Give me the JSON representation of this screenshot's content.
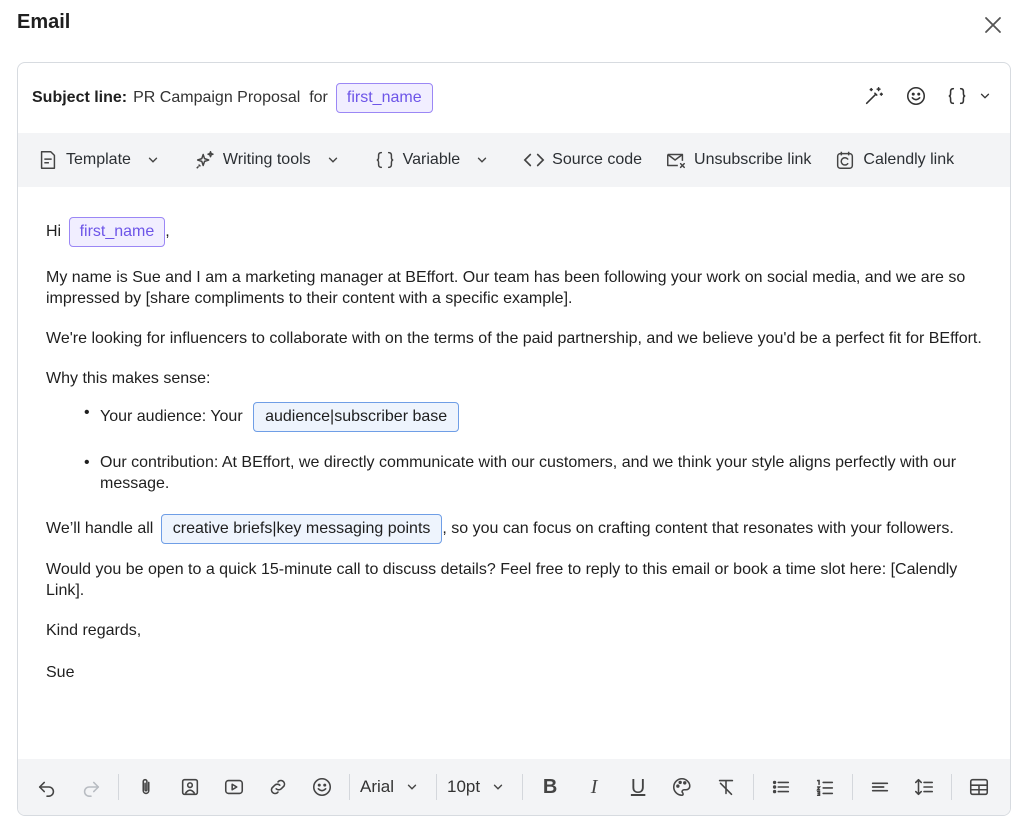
{
  "dialog": {
    "title": "Email"
  },
  "subject": {
    "label": "Subject line:",
    "text": "PR Campaign Proposal  for",
    "variable": "first_name"
  },
  "toolbar": {
    "template": "Template",
    "writing_tools": "Writing tools",
    "variable": "Variable",
    "source_code": "Source code",
    "unsubscribe_link": "Unsubscribe link",
    "calendly_link": "Calendly link"
  },
  "body": {
    "greeting_prefix": "Hi",
    "greeting_variable": "first_name",
    "greeting_suffix": ",",
    "p1": "My name is Sue and I am a marketing manager at BEffort. Our team has been following your work on social media, and we are so impressed by [share compliments to their content with a specific example].",
    "p2": "We're looking for influencers to collaborate with on the terms of the paid partnership, and we believe you'd be a perfect fit for BEffort.",
    "p3": "Why this makes sense:",
    "bullet1_prefix": "Your audience: Your",
    "bullet1_chip": "audience|subscriber base",
    "bullet2": "Our contribution: At BEffort, we directly communicate with our customers, and we think your style aligns perfectly with our message.",
    "p4_prefix": "We’ll handle all",
    "p4_chip": "creative briefs|key messaging points",
    "p4_suffix": ", so you can focus on crafting content that resonates with your followers.",
    "p5": "Would you be open to a quick 15-minute call to discuss details? Feel free to reply to this email or book a time slot here: [Calendly Link].",
    "p6": "Kind regards,",
    "p7": "Sue"
  },
  "format_bar": {
    "font_family": "Arial",
    "font_size": "10pt",
    "bold": "B",
    "italic": "I",
    "underline": "U"
  },
  "colors": {
    "variable_chip": "#6d55e8",
    "placeholder_chip_border": "#6f9ee6",
    "toolbar_bg": "#f3f4f6"
  }
}
